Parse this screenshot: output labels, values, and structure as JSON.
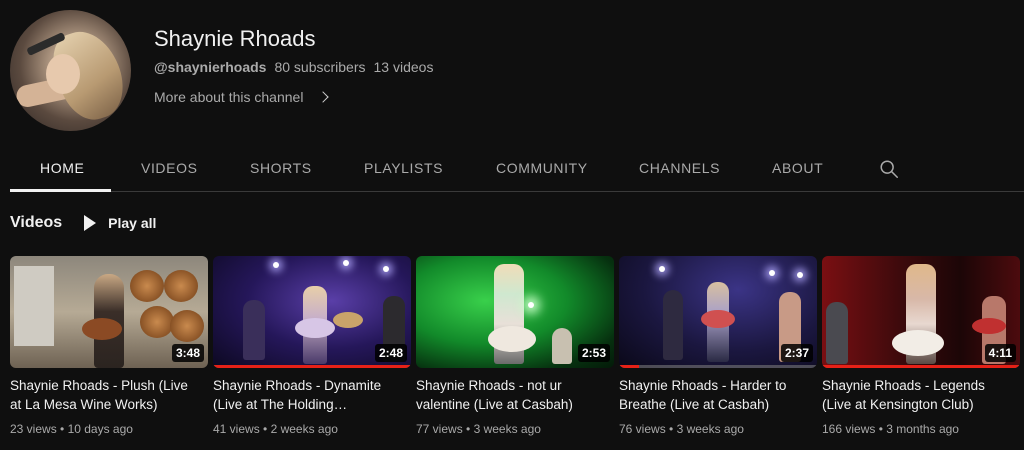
{
  "channel": {
    "name": "Shaynie Rhoads",
    "handle": "@shaynierhoads",
    "subscribers": "80 subscribers",
    "video_count": "13 videos",
    "more_about": "More about this channel"
  },
  "tabs": [
    {
      "label": "HOME",
      "active": true
    },
    {
      "label": "VIDEOS",
      "active": false
    },
    {
      "label": "SHORTS",
      "active": false
    },
    {
      "label": "PLAYLISTS",
      "active": false
    },
    {
      "label": "COMMUNITY",
      "active": false
    },
    {
      "label": "CHANNELS",
      "active": false
    },
    {
      "label": "ABOUT",
      "active": false
    }
  ],
  "search_icon": "search-icon",
  "section": {
    "title": "Videos",
    "play_all": "Play all"
  },
  "videos": [
    {
      "title": "Shaynie Rhoads - Plush (Live at La Mesa Wine Works)",
      "views": "23 views",
      "age": "10 days ago",
      "duration": "3:48",
      "watched_fraction": 0
    },
    {
      "title": "Shaynie Rhoads - Dynamite (Live at The Holding…",
      "views": "41 views",
      "age": "2 weeks ago",
      "duration": "2:48",
      "watched_fraction": 1
    },
    {
      "title": "Shaynie Rhoads - not ur valentine (Live at Casbah)",
      "views": "77 views",
      "age": "3 weeks ago",
      "duration": "2:53",
      "watched_fraction": 0
    },
    {
      "title": "Shaynie Rhoads - Harder to Breathe (Live at Casbah)",
      "views": "76 views",
      "age": "3 weeks ago",
      "duration": "2:37",
      "watched_fraction": 0.1
    },
    {
      "title": "Shaynie Rhoads - Legends (Live at Kensington Club)",
      "views": "166 views",
      "age": "3 months ago",
      "duration": "4:11",
      "watched_fraction": 1
    }
  ],
  "colors": {
    "background": "#0f0f0f",
    "text_primary": "#f1f1f1",
    "text_secondary": "#aaaaaa",
    "progress_red": "#e62117"
  }
}
